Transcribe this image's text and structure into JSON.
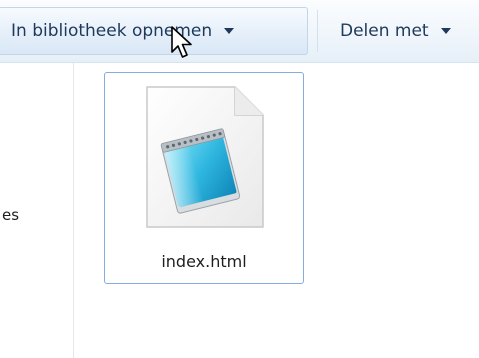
{
  "toolbar": {
    "include_in_library_label": "In bibliotheek opnemen",
    "share_with_label": "Delen met"
  },
  "nav_pane": {
    "partial_item_label": "es"
  },
  "files": [
    {
      "name": "index.html",
      "icon": "notepad-document-icon",
      "selected": true
    }
  ],
  "cursor": {
    "icon": "mouse-pointer-icon"
  }
}
